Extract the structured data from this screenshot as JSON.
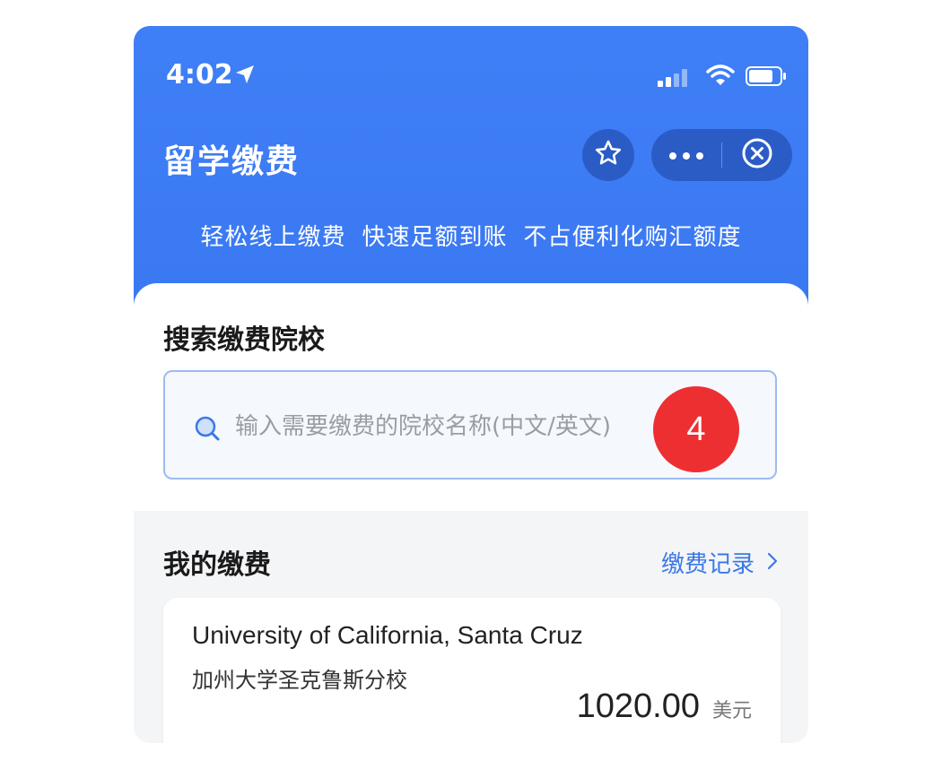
{
  "status_bar": {
    "time": "4:02",
    "location_icon": "location-arrow-icon",
    "signal_icon": "cellular-signal-icon",
    "wifi_icon": "wifi-icon",
    "battery_icon": "battery-icon"
  },
  "header": {
    "title": "留学缴费",
    "star_icon": "star-icon",
    "more_icon": "more-dots-icon",
    "close_icon": "close-circle-icon",
    "features": [
      "轻松线上缴费",
      "快速足额到账",
      "不占便利化购汇额度"
    ],
    "background_color": "#3d7cf5"
  },
  "search": {
    "title": "搜索缴费院校",
    "placeholder": "输入需要缴费的院校名称(中文/英文)",
    "icon": "search-icon",
    "badge": "4"
  },
  "my_payments": {
    "title": "我的缴费",
    "records_link": "缴费记录",
    "chevron_icon": "chevron-right-icon",
    "items": [
      {
        "name_en": "University of California, Santa Cruz",
        "name_cn": "加州大学圣克鲁斯分校",
        "amount": "1020.00",
        "currency": "美元"
      }
    ]
  },
  "colors": {
    "accent": "#3b78e7",
    "badge": "#ee2f32"
  }
}
